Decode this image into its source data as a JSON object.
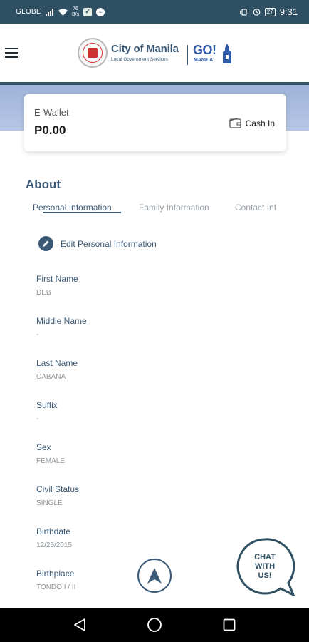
{
  "status_bar": {
    "carrier": "GLOBE",
    "speed_top": "76",
    "speed_bottom": "B/s",
    "battery": "27",
    "time": "9:31"
  },
  "header": {
    "brand_title": "City of Manila",
    "brand_subtitle": "Local Government Services",
    "go_label": "GO!",
    "go_sub": "MANILA"
  },
  "wallet": {
    "label": "E-Wallet",
    "amount": "P0.00",
    "cash_in_label": "Cash In"
  },
  "about": {
    "title": "About",
    "tabs": [
      {
        "label": "Personal Information"
      },
      {
        "label": "Family Information"
      },
      {
        "label": "Contact Inf"
      }
    ],
    "edit_label": "Edit Personal Information",
    "fields": [
      {
        "label": "First Name",
        "value": "DEB"
      },
      {
        "label": "Middle Name",
        "value": "-"
      },
      {
        "label": "Last Name",
        "value": "CABANA"
      },
      {
        "label": "Suffix",
        "value": "-"
      },
      {
        "label": "Sex",
        "value": "FEMALE"
      },
      {
        "label": "Civil Status",
        "value": "SINGLE"
      },
      {
        "label": "Birthdate",
        "value": "12/25/2015"
      },
      {
        "label": "Birthplace",
        "value": "TONDO I / II"
      }
    ]
  },
  "chat": {
    "line1": "CHAT",
    "line2": "WITH",
    "line3": "US!"
  },
  "icons": {
    "menu": "hamburger-icon",
    "wallet": "wallet-icon",
    "edit": "pencil-icon",
    "navigate": "navigation-arrow-icon",
    "back": "back-triangle-icon",
    "home": "home-circle-icon",
    "recents": "recents-square-icon"
  },
  "colors": {
    "primary": "#3b5a78",
    "status_bar": "#2f4f63",
    "band": "#9eb3d8"
  }
}
